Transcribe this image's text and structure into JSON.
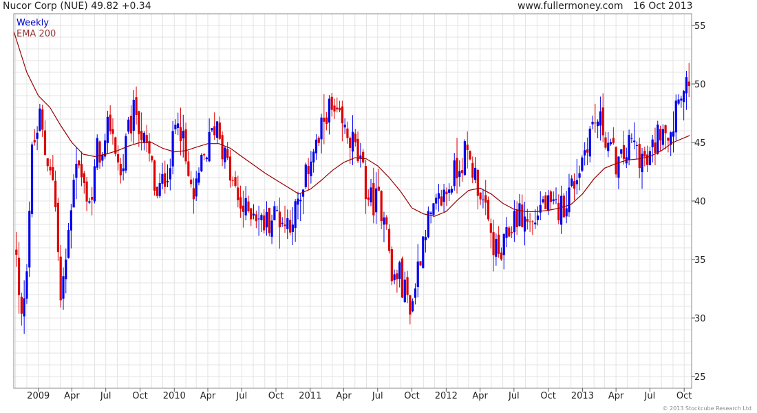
{
  "header": {
    "title": "Nucor Corp (NUE) 49.82 +0.34",
    "website": "www.fullermoney.com",
    "date": "16 Oct 2013"
  },
  "footer": {
    "copyright": "© 2013 Stockcube Research Ltd"
  },
  "colors": {
    "up": "#0000ee",
    "down": "#dd0000",
    "ema": "#990000",
    "grid": "#e3e3e3",
    "legend_weekly": "#0000cc",
    "legend_ema": "#993333"
  },
  "chart_data": {
    "type": "candlestick",
    "interval": "Weekly",
    "legend": [
      {
        "name": "Weekly",
        "color": "#0000cc"
      },
      {
        "name": "EMA 200",
        "color": "#993333"
      }
    ],
    "legend_position": "top-left",
    "grid": true,
    "y_axis": {
      "side": "right",
      "range": [
        24,
        56
      ],
      "ticks": [
        25,
        30,
        35,
        40,
        45,
        50,
        55
      ]
    },
    "x_axis": {
      "range": [
        "2008-10-27",
        "2013-10-21"
      ],
      "ticks": [
        {
          "label": "2009",
          "date": "2009-01-01"
        },
        {
          "label": "Apr",
          "date": "2009-04-01"
        },
        {
          "label": "Jul",
          "date": "2009-07-01"
        },
        {
          "label": "Oct",
          "date": "2009-10-01"
        },
        {
          "label": "2010",
          "date": "2010-01-01"
        },
        {
          "label": "Apr",
          "date": "2010-04-01"
        },
        {
          "label": "Jul",
          "date": "2010-07-01"
        },
        {
          "label": "Oct",
          "date": "2010-10-01"
        },
        {
          "label": "2011",
          "date": "2011-01-01"
        },
        {
          "label": "Apr",
          "date": "2011-04-01"
        },
        {
          "label": "Jul",
          "date": "2011-07-01"
        },
        {
          "label": "Oct",
          "date": "2011-10-01"
        },
        {
          "label": "2012",
          "date": "2012-01-01"
        },
        {
          "label": "Apr",
          "date": "2012-04-01"
        },
        {
          "label": "Jul",
          "date": "2012-07-01"
        },
        {
          "label": "Oct",
          "date": "2012-10-01"
        },
        {
          "label": "2013",
          "date": "2013-01-01"
        },
        {
          "label": "Apr",
          "date": "2013-04-01"
        },
        {
          "label": "Jul",
          "date": "2013-07-01"
        },
        {
          "label": "Oct",
          "date": "2013-10-01"
        }
      ]
    },
    "close_path": [
      [
        "2008-11-01",
        36
      ],
      [
        "2008-11-15",
        29
      ],
      [
        "2008-12-01",
        35
      ],
      [
        "2008-12-15",
        44
      ],
      [
        "2009-01-05",
        47
      ],
      [
        "2009-01-20",
        44
      ],
      [
        "2009-02-05",
        43
      ],
      [
        "2009-02-20",
        38
      ],
      [
        "2009-03-01",
        31
      ],
      [
        "2009-03-10",
        33
      ],
      [
        "2009-03-25",
        38
      ],
      [
        "2009-04-10",
        44
      ],
      [
        "2009-05-05",
        41
      ],
      [
        "2009-05-25",
        40
      ],
      [
        "2009-06-10",
        45
      ],
      [
        "2009-06-25",
        43
      ],
      [
        "2009-07-10",
        47
      ],
      [
        "2009-07-25",
        45
      ],
      [
        "2009-08-10",
        42
      ],
      [
        "2009-09-01",
        46
      ],
      [
        "2009-09-20",
        48
      ],
      [
        "2009-10-10",
        45
      ],
      [
        "2009-11-01",
        43
      ],
      [
        "2009-11-15",
        40
      ],
      [
        "2009-12-05",
        42
      ],
      [
        "2009-12-25",
        44
      ],
      [
        "2010-01-10",
        48
      ],
      [
        "2010-01-20",
        46
      ],
      [
        "2010-02-05",
        42
      ],
      [
        "2010-02-25",
        40
      ],
      [
        "2010-03-15",
        43
      ],
      [
        "2010-04-05",
        45
      ],
      [
        "2010-04-25",
        47
      ],
      [
        "2010-05-15",
        44
      ],
      [
        "2010-06-01",
        42
      ],
      [
        "2010-06-20",
        40
      ],
      [
        "2010-07-10",
        39
      ],
      [
        "2010-08-01",
        39.5
      ],
      [
        "2010-08-25",
        38
      ],
      [
        "2010-09-15",
        38.5
      ],
      [
        "2010-10-05",
        39
      ],
      [
        "2010-10-25",
        38
      ],
      [
        "2010-11-20",
        39
      ],
      [
        "2010-12-10",
        40
      ],
      [
        "2011-01-01",
        44
      ],
      [
        "2011-01-25",
        45
      ],
      [
        "2011-02-15",
        48
      ],
      [
        "2011-03-10",
        47
      ],
      [
        "2011-04-01",
        46
      ],
      [
        "2011-04-25",
        45
      ],
      [
        "2011-05-15",
        43
      ],
      [
        "2011-06-10",
        40
      ],
      [
        "2011-07-01",
        40
      ],
      [
        "2011-07-25",
        39
      ],
      [
        "2011-08-05",
        33
      ],
      [
        "2011-08-25",
        34
      ],
      [
        "2011-09-15",
        32
      ],
      [
        "2011-10-01",
        31
      ],
      [
        "2011-10-15",
        34
      ],
      [
        "2011-11-05",
        38
      ],
      [
        "2011-11-25",
        38.5
      ],
      [
        "2011-12-15",
        40
      ],
      [
        "2012-01-05",
        41
      ],
      [
        "2012-02-01",
        43
      ],
      [
        "2012-02-20",
        44
      ],
      [
        "2012-03-10",
        43
      ],
      [
        "2012-04-01",
        41
      ],
      [
        "2012-04-20",
        38
      ],
      [
        "2012-05-10",
        36
      ],
      [
        "2012-05-25",
        35
      ],
      [
        "2012-06-15",
        37
      ],
      [
        "2012-07-05",
        39
      ],
      [
        "2012-07-25",
        38.5
      ],
      [
        "2012-08-20",
        38
      ],
      [
        "2012-09-15",
        40
      ],
      [
        "2012-10-10",
        39
      ],
      [
        "2012-11-05",
        39.5
      ],
      [
        "2012-12-01",
        41
      ],
      [
        "2012-12-25",
        43
      ],
      [
        "2013-01-20",
        46
      ],
      [
        "2013-02-10",
        47
      ],
      [
        "2013-02-28",
        46
      ],
      [
        "2013-03-20",
        44
      ],
      [
        "2013-04-10",
        43
      ],
      [
        "2013-04-25",
        44
      ],
      [
        "2013-05-15",
        45
      ],
      [
        "2013-06-05",
        44
      ],
      [
        "2013-06-25",
        43
      ],
      [
        "2013-07-15",
        45
      ],
      [
        "2013-08-05",
        47
      ],
      [
        "2013-08-20",
        46
      ],
      [
        "2013-09-01",
        46.5
      ],
      [
        "2013-09-15",
        50
      ],
      [
        "2013-10-01",
        49
      ],
      [
        "2013-10-16",
        49.82
      ]
    ],
    "ema200_path": [
      [
        "2008-10-27",
        54.5
      ],
      [
        "2008-12-01",
        51
      ],
      [
        "2009-01-01",
        49
      ],
      [
        "2009-02-01",
        48
      ],
      [
        "2009-03-01",
        46.5
      ],
      [
        "2009-04-01",
        45
      ],
      [
        "2009-05-01",
        44
      ],
      [
        "2009-06-01",
        43.8
      ],
      [
        "2009-07-01",
        44
      ],
      [
        "2009-08-01",
        44.3
      ],
      [
        "2009-09-01",
        44.7
      ],
      [
        "2009-10-01",
        45
      ],
      [
        "2009-11-01",
        45
      ],
      [
        "2009-12-01",
        44.5
      ],
      [
        "2010-01-01",
        44.2
      ],
      [
        "2010-02-01",
        44.3
      ],
      [
        "2010-03-01",
        44.6
      ],
      [
        "2010-04-01",
        44.9
      ],
      [
        "2010-05-01",
        44.9
      ],
      [
        "2010-06-01",
        44.5
      ],
      [
        "2010-07-01",
        43.8
      ],
      [
        "2010-08-01",
        43.1
      ],
      [
        "2010-09-01",
        42.4
      ],
      [
        "2010-10-01",
        41.8
      ],
      [
        "2010-11-01",
        41.2
      ],
      [
        "2010-12-01",
        40.6
      ],
      [
        "2011-01-01",
        41
      ],
      [
        "2011-02-01",
        41.8
      ],
      [
        "2011-03-01",
        42.6
      ],
      [
        "2011-04-01",
        43.3
      ],
      [
        "2011-05-01",
        43.7
      ],
      [
        "2011-06-01",
        43.6
      ],
      [
        "2011-07-01",
        43
      ],
      [
        "2011-08-01",
        42
      ],
      [
        "2011-09-01",
        40.8
      ],
      [
        "2011-10-01",
        39.4
      ],
      [
        "2011-11-01",
        38.9
      ],
      [
        "2011-12-01",
        38.7
      ],
      [
        "2012-01-01",
        39.1
      ],
      [
        "2012-02-01",
        40.1
      ],
      [
        "2012-03-01",
        40.9
      ],
      [
        "2012-04-01",
        41.1
      ],
      [
        "2012-05-01",
        40.6
      ],
      [
        "2012-06-01",
        39.8
      ],
      [
        "2012-07-01",
        39.3
      ],
      [
        "2012-08-01",
        39.1
      ],
      [
        "2012-09-01",
        39.1
      ],
      [
        "2012-10-01",
        39.2
      ],
      [
        "2012-11-01",
        39.4
      ],
      [
        "2012-12-01",
        39.7
      ],
      [
        "2013-01-01",
        40.6
      ],
      [
        "2013-02-01",
        41.9
      ],
      [
        "2013-03-01",
        42.8
      ],
      [
        "2013-04-01",
        43.2
      ],
      [
        "2013-05-01",
        43.5
      ],
      [
        "2013-06-01",
        43.6
      ],
      [
        "2013-07-01",
        43.8
      ],
      [
        "2013-08-01",
        44.3
      ],
      [
        "2013-09-01",
        45
      ],
      [
        "2013-10-16",
        45.6
      ]
    ]
  }
}
